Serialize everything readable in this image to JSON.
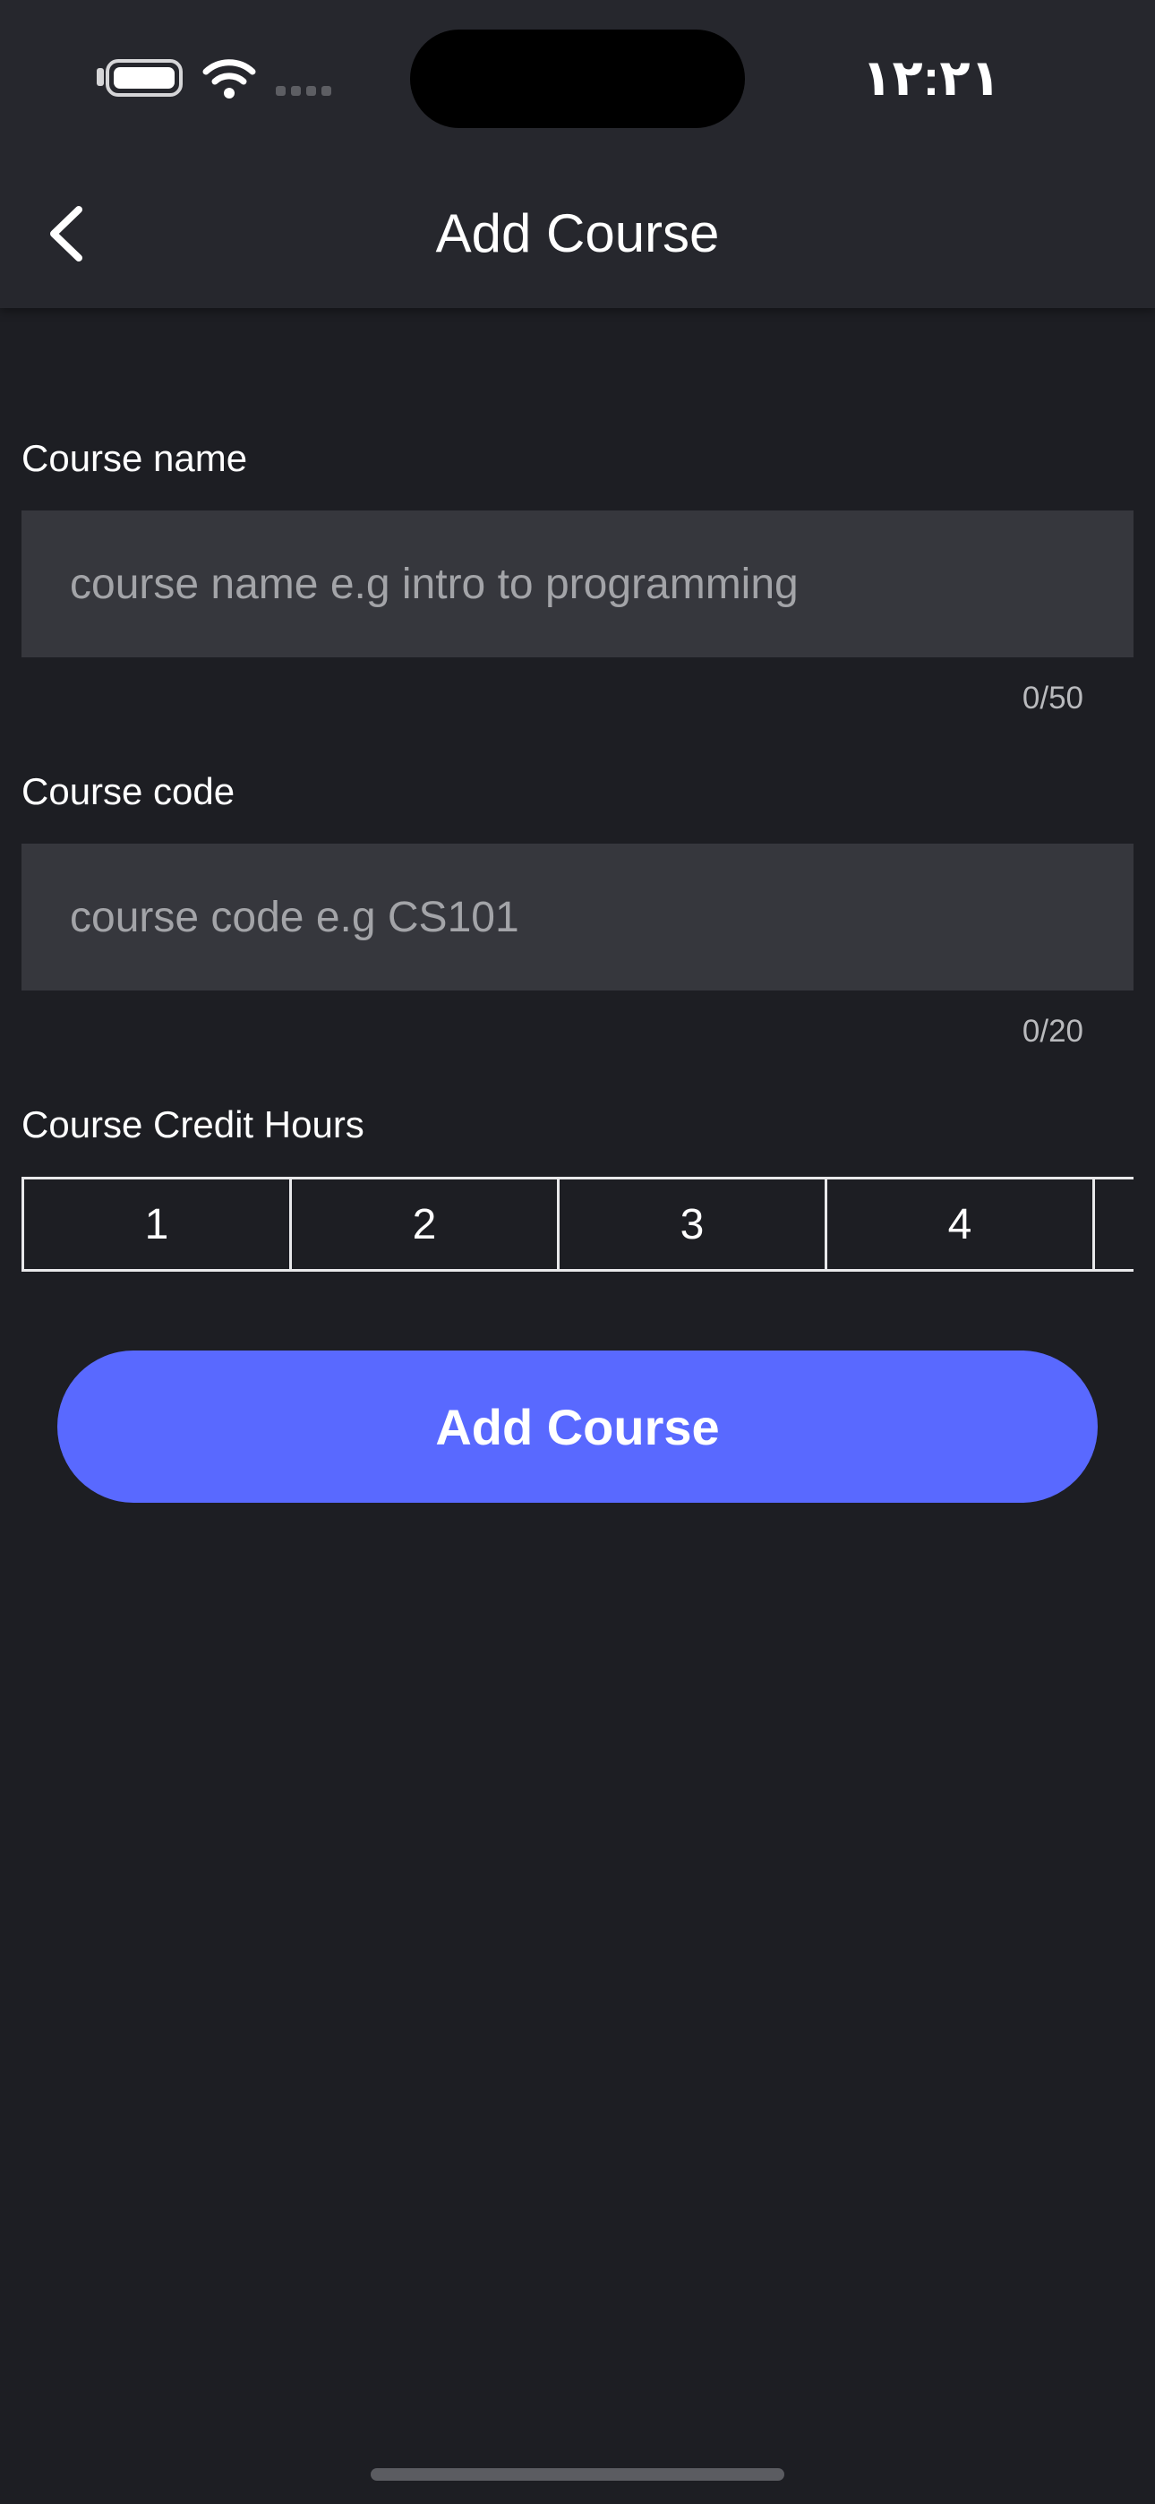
{
  "status_bar": {
    "time": "۱۲:۲۱",
    "icons": [
      "battery-icon",
      "wifi-icon",
      "cellular-signal-icon"
    ]
  },
  "nav": {
    "title": "Add Course",
    "back_icon": "chevron-left-icon"
  },
  "form": {
    "course_name": {
      "label": "Course name",
      "placeholder": "course name e.g intro to programming",
      "value": "",
      "counter": "0/50"
    },
    "course_code": {
      "label": "Course code",
      "placeholder": "course code e.g CS101",
      "value": "",
      "counter": "0/20"
    },
    "credit_hours": {
      "label": "Course Credit Hours",
      "options": [
        "1",
        "2",
        "3",
        "4"
      ]
    },
    "submit_label": "Add Course"
  },
  "colors": {
    "background": "#1d1e23",
    "header": "#26272d",
    "input_background": "#36373d",
    "accent": "#5969ff"
  }
}
